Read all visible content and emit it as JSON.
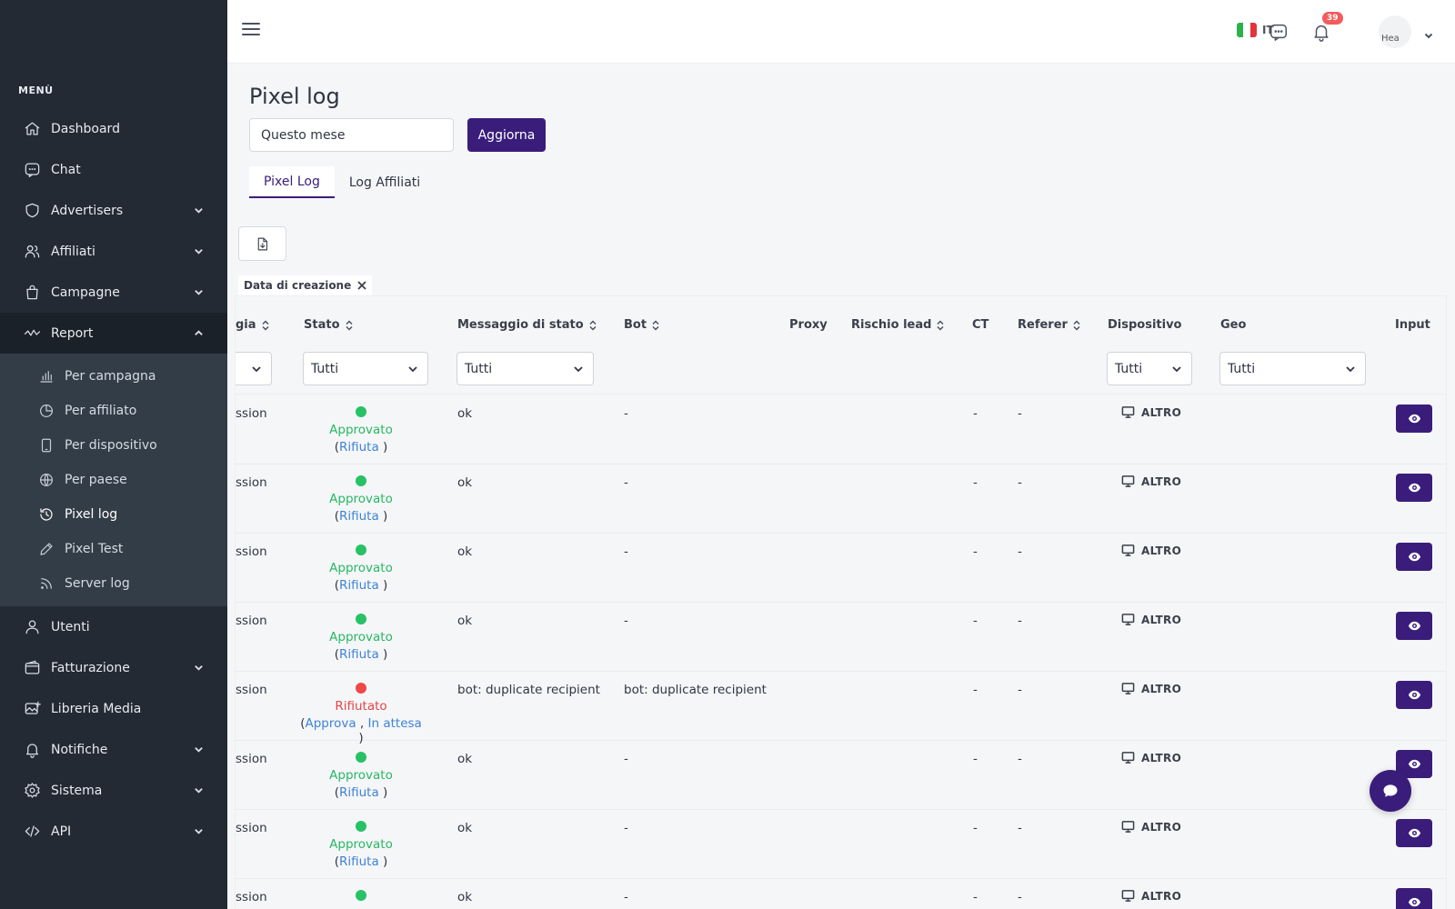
{
  "sidebar": {
    "menu_heading": "MENÙ",
    "items": [
      {
        "label": "Dashboard",
        "icon": "home-icon"
      },
      {
        "label": "Chat",
        "icon": "chat-icon"
      },
      {
        "label": "Advertisers",
        "icon": "shield-icon",
        "expandable": true
      },
      {
        "label": "Affiliati",
        "icon": "users-icon",
        "expandable": true
      },
      {
        "label": "Campagne",
        "icon": "bag-icon",
        "expandable": true
      },
      {
        "label": "Report",
        "icon": "activity-icon",
        "expandable": true,
        "open": true
      }
    ],
    "report_sub": [
      {
        "label": "Per campagna",
        "icon": "bar-chart-icon"
      },
      {
        "label": "Per affiliato",
        "icon": "pie-chart-icon"
      },
      {
        "label": "Per dispositivo",
        "icon": "tablet-icon"
      },
      {
        "label": "Per paese",
        "icon": "globe-icon"
      },
      {
        "label": "Pixel log",
        "icon": "history-icon",
        "active": true
      },
      {
        "label": "Pixel Test",
        "icon": "pen-icon"
      },
      {
        "label": "Server log",
        "icon": "rss-icon"
      }
    ],
    "items_after": [
      {
        "label": "Utenti",
        "icon": "user-icon"
      },
      {
        "label": "Fatturazione",
        "icon": "wallet-icon",
        "expandable": true
      },
      {
        "label": "Libreria Media",
        "icon": "image-icon"
      },
      {
        "label": "Notifiche",
        "icon": "bell-icon",
        "expandable": true
      },
      {
        "label": "Sistema",
        "icon": "gear-icon",
        "expandable": true
      },
      {
        "label": "API",
        "icon": "code-icon",
        "expandable": true
      }
    ]
  },
  "topbar": {
    "language": "IT",
    "notification_count": "39",
    "avatar_alt": "Hea"
  },
  "page": {
    "title": "Pixel log",
    "period_value": "Questo mese",
    "refresh_label": "Aggiorna",
    "tabs": [
      "Pixel Log",
      "Log Affiliati"
    ],
    "active_filter_chip": "Data di creazione"
  },
  "table": {
    "headers": {
      "partial": "gia",
      "stato": "Stato",
      "messaggio": "Messaggio di stato",
      "bot": "Bot",
      "proxy": "Proxy",
      "rischio": "Rischio lead",
      "ct": "CT",
      "referer": "Referer",
      "dispositivo": "Dispositivo",
      "geo": "Geo",
      "input": "Input"
    },
    "filters": {
      "stato": "Tutti",
      "messaggio": "Tutti",
      "dispositivo": "Tutti",
      "geo": "Tutti"
    },
    "action_labels": {
      "rifiuta": "Rifiuta",
      "approva": "Approva",
      "in_attesa": "In attesa"
    },
    "rows": [
      {
        "type": "ssion",
        "status": "Approvato",
        "status_color": "green",
        "message": "ok",
        "bot": "-",
        "ct": "-",
        "referer": "-",
        "device": "ALTRO"
      },
      {
        "type": "ssion",
        "status": "Approvato",
        "status_color": "green",
        "message": "ok",
        "bot": "-",
        "ct": "-",
        "referer": "-",
        "device": "ALTRO"
      },
      {
        "type": "ssion",
        "status": "Approvato",
        "status_color": "green",
        "message": "ok",
        "bot": "-",
        "ct": "-",
        "referer": "-",
        "device": "ALTRO"
      },
      {
        "type": "ssion",
        "status": "Approvato",
        "status_color": "green",
        "message": "ok",
        "bot": "-",
        "ct": "-",
        "referer": "-",
        "device": "ALTRO"
      },
      {
        "type": "ssion",
        "status": "Rifiutato",
        "status_color": "red",
        "message": "bot: duplicate recipient",
        "bot": "bot: duplicate recipient",
        "ct": "-",
        "referer": "-",
        "device": "ALTRO"
      },
      {
        "type": "ssion",
        "status": "Approvato",
        "status_color": "green",
        "message": "ok",
        "bot": "-",
        "ct": "-",
        "referer": "-",
        "device": "ALTRO"
      },
      {
        "type": "ssion",
        "status": "Approvato",
        "status_color": "green",
        "message": "ok",
        "bot": "-",
        "ct": "-",
        "referer": "-",
        "device": "ALTRO"
      },
      {
        "type": "ssion",
        "status": "",
        "status_color": "green",
        "message": "ok",
        "bot": "-",
        "ct": "-",
        "referer": "-",
        "device": "ALTRO"
      }
    ]
  },
  "colors": {
    "accent": "#3a1d7a",
    "sidebar_bg": "#232a34",
    "approved": "#27c265",
    "rejected": "#ef4848",
    "link": "#3e83d6"
  }
}
